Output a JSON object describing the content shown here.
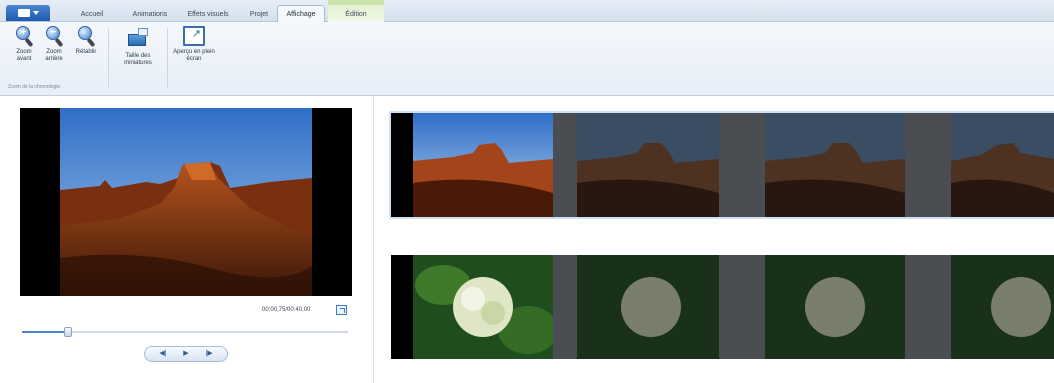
{
  "ribbon": {
    "tabs": [
      {
        "label": "Accueil"
      },
      {
        "label": "Animations"
      },
      {
        "label": "Effets visuels"
      },
      {
        "label": "Projet"
      },
      {
        "label": "Affichage"
      },
      {
        "label": "Édition"
      }
    ],
    "active_tab": "Affichage",
    "buttons": {
      "zoom_in": "Zoom avant",
      "zoom_out": "Zoom arrière",
      "reset": "Rétablir",
      "thumbnail_size": "Taille des miniatures",
      "fullscreen_preview": "Aperçu en plein écran"
    },
    "group_caption": "Zoom de la chronologie"
  },
  "preview": {
    "timecode": "00:00,75/00:40,00",
    "seek_progress": 0.14
  },
  "colors": {
    "accent": "#2f6fbf",
    "selection": "#cfe0f3",
    "gap": "#4a4d52"
  },
  "storyboard": {
    "clips": [
      {
        "subject": "desert-butte",
        "selected": true
      },
      {
        "subject": "white-hydrangea",
        "selected": false
      }
    ]
  }
}
